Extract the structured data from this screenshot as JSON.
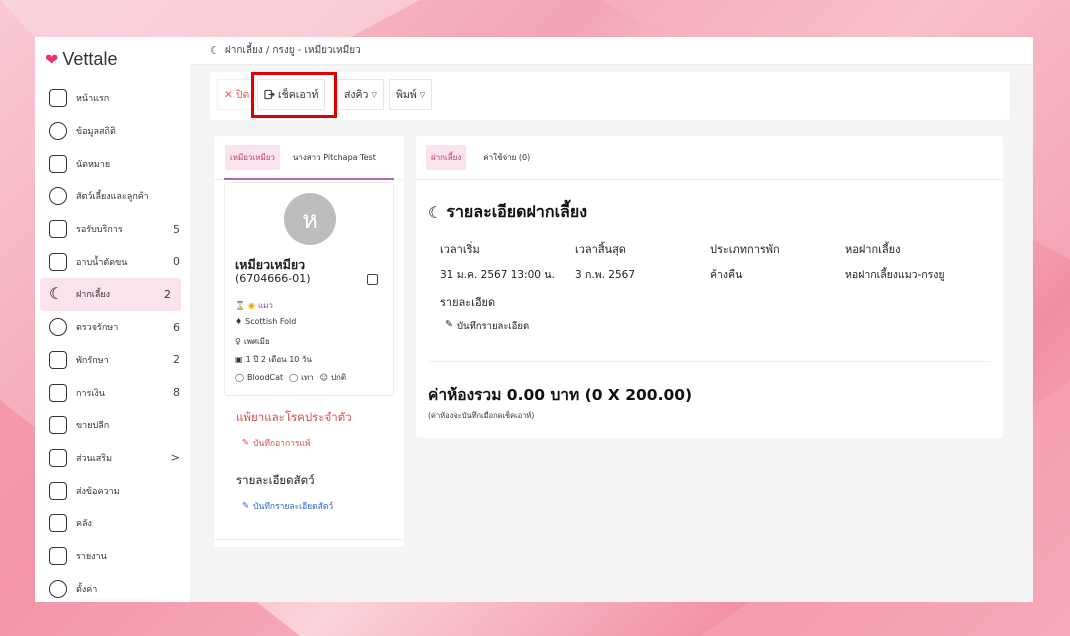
{
  "app": {
    "name": "Vettale"
  },
  "sidebar": {
    "items": [
      {
        "label": "หน้าแรก",
        "count": "",
        "icon": "home-icon"
      },
      {
        "label": "ข้อมูลสถิติ",
        "count": "",
        "icon": "dashboard-icon"
      },
      {
        "label": "นัดหมาย",
        "count": "",
        "icon": "calendar-icon"
      },
      {
        "label": "สัตว์เลี้ยงและลูกค้า",
        "count": "",
        "icon": "paw-icon"
      },
      {
        "label": "รอรับบริการ",
        "count": "5",
        "icon": "sofa-icon"
      },
      {
        "label": "อาบน้ำตัดขน",
        "count": "0",
        "icon": "bathtub-icon"
      },
      {
        "label": "ฝากเลี้ยง",
        "count": "2",
        "icon": "moon-icon",
        "active": true
      },
      {
        "label": "ตรวจรักษา",
        "count": "6",
        "icon": "stethoscope-icon"
      },
      {
        "label": "พักรักษา",
        "count": "2",
        "icon": "bed-icon"
      },
      {
        "label": "การเงิน",
        "count": "8",
        "icon": "money-icon"
      },
      {
        "label": "ขายปลีก",
        "count": "",
        "icon": "cash-register-icon"
      },
      {
        "label": "ส่วนเสริม",
        "count": ">",
        "icon": "plus-square-icon"
      },
      {
        "label": "ส่งข้อความ",
        "count": "",
        "icon": "send-icon"
      },
      {
        "label": "คลัง",
        "count": "",
        "icon": "archive-icon"
      },
      {
        "label": "รายงาน",
        "count": "",
        "icon": "chart-icon"
      },
      {
        "label": "ตั้งค่า",
        "count": "",
        "icon": "gear-icon"
      }
    ]
  },
  "breadcrumb": {
    "text": "ฝากเลี้ยง / กรงยู - เหมียวเหมียว"
  },
  "toolbar": {
    "close_label": "ปิด",
    "checkout_label": "เช็คเอาท์",
    "send_label": "ส่งคิว",
    "print_label": "พิมพ์"
  },
  "pet_card": {
    "tabs": [
      "เหมียวเหมียว",
      "นางสาว Pitchapa Test"
    ],
    "avatar_initial": "ห",
    "name": "เหมียวเหมียว",
    "id": "(6704666-01)",
    "species": "แมว",
    "breed": "Scottish Fold",
    "sex": "เพศเมีย",
    "age": "1 ปี 2 เดือน 10 วัน",
    "tag1": "BloodCat",
    "tag2": "เทา",
    "tag3": "ปกติ",
    "allergy_title": "แพ้ยาและโรคประจำตัว",
    "allergy_link": "บันทึกอาการแพ้",
    "detail_title": "รายละเอียดสัตว์",
    "detail_link": "บันทึกรายละเอียดสัตว์"
  },
  "boarding": {
    "tabs": [
      "ฝากเลี้ยง",
      "ค่าใช้จ่าย (0)"
    ],
    "title": "รายละเอียดฝากเลี้ยง",
    "columns": [
      {
        "header": "เวลาเริ่ม",
        "value": "31 ม.ค. 2567 13:00 น."
      },
      {
        "header": "เวลาสิ้นสุด",
        "value": "3 ก.พ. 2567"
      },
      {
        "header": "ประเภทการพัก",
        "value": "ค้างคืน"
      },
      {
        "header": "หอฝากเลี้ยง",
        "value": "หอฝากเลี้ยงแมว-กรงยู"
      }
    ],
    "detail_label": "รายละเอียด",
    "detail_link": "บันทึกรายละเอียด",
    "total": "ค่าห้องรวม 0.00 บาท (0 X 200.00)",
    "total_note": "(ค่าห้องจะบันทึกเมื่อกดเช็คเอาท์)"
  },
  "colors": {
    "brand": "#e8336d",
    "highlight": "#e00000",
    "active_bg": "#fbe3ec",
    "link_blue": "#2f66c9",
    "alert_red": "#e04b4b"
  }
}
